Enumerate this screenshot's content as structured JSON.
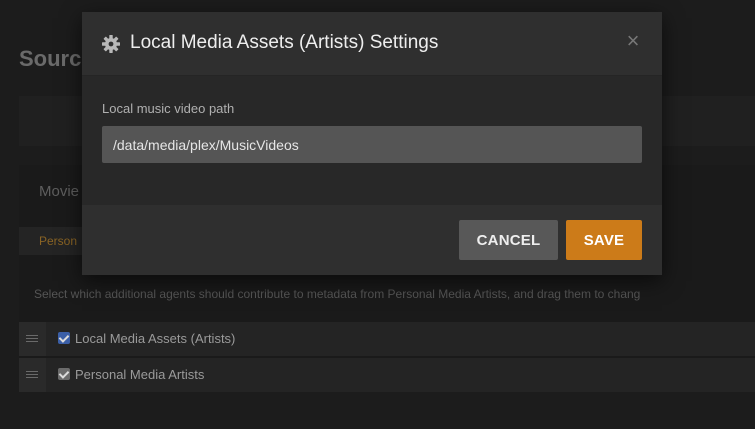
{
  "background": {
    "title": "Sourc",
    "movie_heading": "Movie",
    "tab_label": "Person",
    "description": "Select which additional agents should contribute to metadata from Personal Media Artists, and drag them to chang",
    "agents": [
      {
        "label": "Local Media Assets (Artists)",
        "checked": true
      },
      {
        "label": "Personal Media Artists",
        "checked": true
      }
    ]
  },
  "modal": {
    "title": "Local Media Assets (Artists) Settings",
    "icon": "gear-icon",
    "close_glyph": "×",
    "field": {
      "label": "Local music video path",
      "value": "/data/media/plex/MusicVideos"
    },
    "buttons": {
      "cancel": "CANCEL",
      "save": "SAVE"
    }
  },
  "colors": {
    "accent": "#cc7b19",
    "checkbox_checked": "#3b5fa7"
  }
}
